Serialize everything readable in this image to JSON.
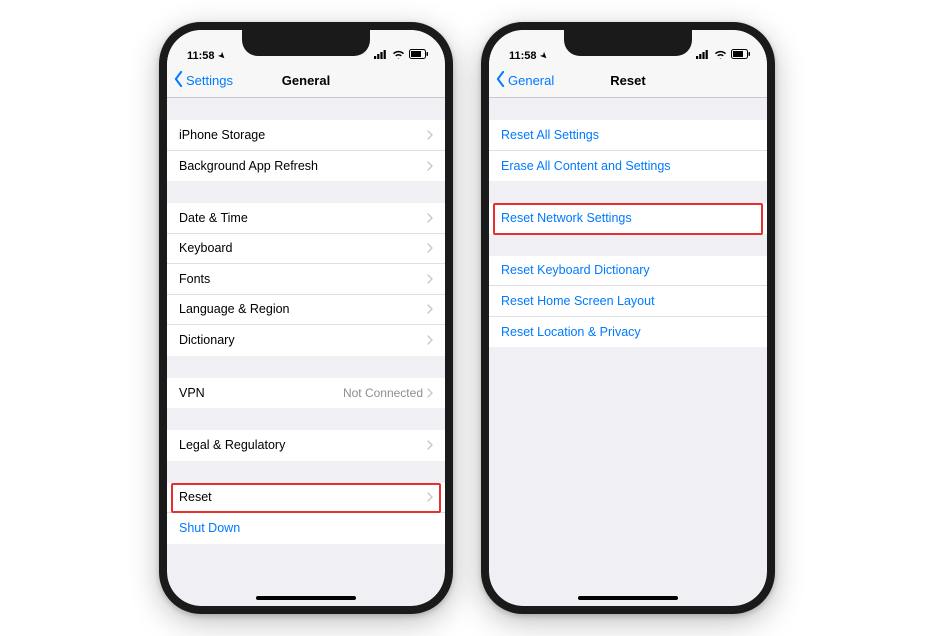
{
  "status": {
    "time": "11:58",
    "location_icon": "◀"
  },
  "phone1": {
    "back": "Settings",
    "title": "General",
    "g1": [
      {
        "label": "iPhone Storage"
      },
      {
        "label": "Background App Refresh"
      }
    ],
    "g2": [
      {
        "label": "Date & Time"
      },
      {
        "label": "Keyboard"
      },
      {
        "label": "Fonts"
      },
      {
        "label": "Language & Region"
      },
      {
        "label": "Dictionary"
      }
    ],
    "g3": [
      {
        "label": "VPN",
        "detail": "Not Connected"
      }
    ],
    "g4": [
      {
        "label": "Legal & Regulatory"
      }
    ],
    "g5": [
      {
        "label": "Reset",
        "highlight": true
      },
      {
        "label": "Shut Down",
        "blue": true,
        "nochevron": true
      }
    ]
  },
  "phone2": {
    "back": "General",
    "title": "Reset",
    "g1": [
      {
        "label": "Reset All Settings"
      },
      {
        "label": "Erase All Content and Settings"
      }
    ],
    "g2": [
      {
        "label": "Reset Network Settings",
        "highlight": true
      }
    ],
    "g3": [
      {
        "label": "Reset Keyboard Dictionary"
      },
      {
        "label": "Reset Home Screen Layout"
      },
      {
        "label": "Reset Location & Privacy"
      }
    ]
  }
}
